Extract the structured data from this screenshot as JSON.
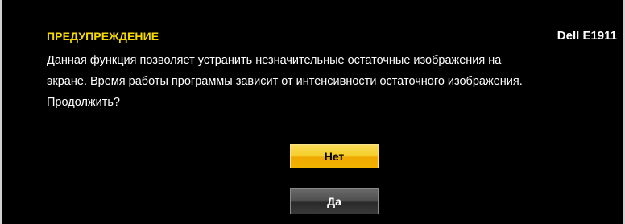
{
  "dialog": {
    "title": "ПРЕДУПРЕЖДЕНИЕ",
    "model": "Dell E1911",
    "message_lines": [
      "Данная функция позволяет устранить незначительные остаточные изображения на",
      "экране. Время работы программы зависит от интенсивности остаточного изображения.",
      "Продолжить?"
    ]
  },
  "buttons": {
    "no_label": "Нет",
    "yes_label": "Да"
  },
  "colors": {
    "background": "#000000",
    "title": "#f4d800",
    "selected_button": "#f2b200",
    "unselected_button": "#3a3a3a"
  }
}
